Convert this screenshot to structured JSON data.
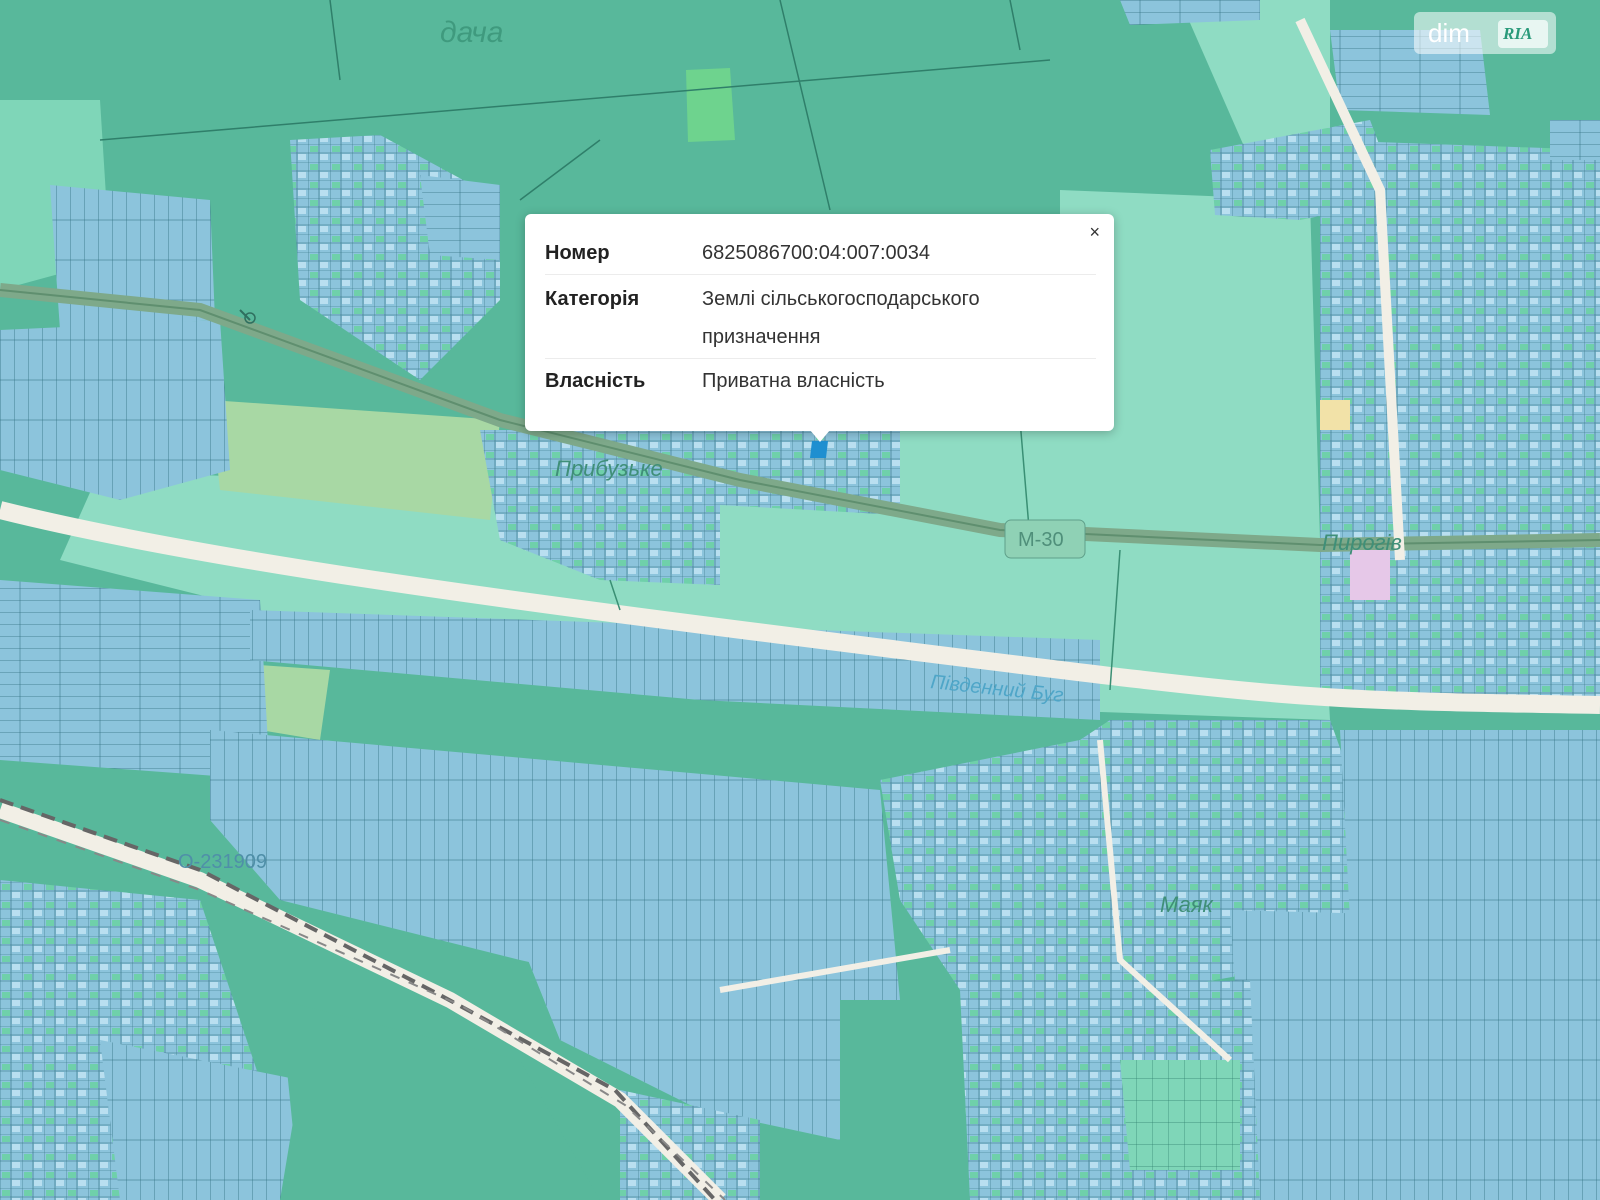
{
  "map": {
    "labels": {
      "forest_name": "дача",
      "village_1": "Прибузьке",
      "highway": "М-30",
      "village_2": "Пирогів",
      "river": "Південний Буг",
      "road_code": "О-231909",
      "village_3": "Маяк"
    },
    "colors": {
      "forest": "#58b89b",
      "agricultural": "#8fdcc3",
      "parcel_blue": "#8cc4dc",
      "parcel_green": "#6fd0aa",
      "road": "#f2efe6",
      "highway": "#7ea98a",
      "highlight": "#1f8fd0"
    }
  },
  "popup": {
    "close_label": "×",
    "rows": [
      {
        "label": "Номер",
        "value": "6825086700:04:007:0034"
      },
      {
        "label": "Категорія",
        "value": "Землі сільськогосподарського призначення"
      },
      {
        "label": "Власність",
        "value": "Приватна власність"
      }
    ]
  },
  "logo": {
    "text": "dim",
    "badge": "RIA"
  }
}
